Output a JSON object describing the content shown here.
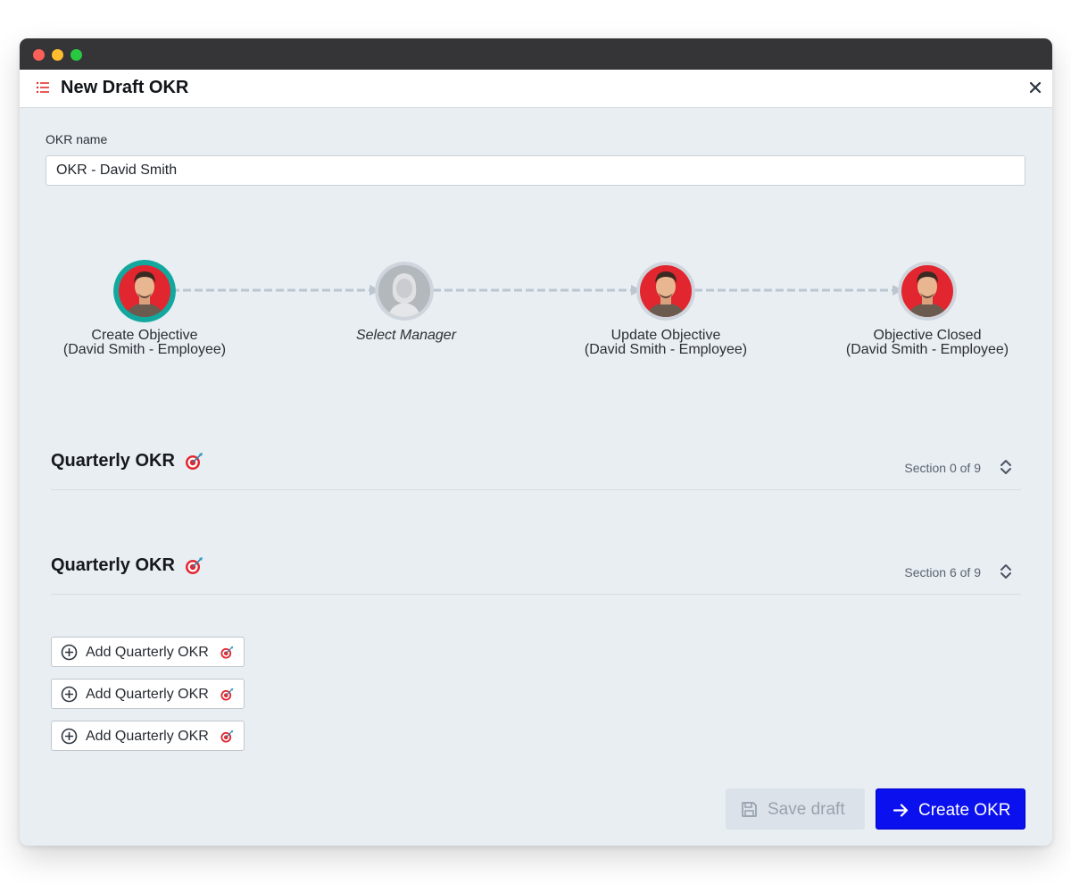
{
  "header": {
    "title": "New Draft OKR"
  },
  "form": {
    "okr_name_label": "OKR name",
    "okr_name_value": "OKR - David Smith"
  },
  "workflow": {
    "steps": [
      {
        "title": "Create Objective",
        "subtitle": "(David Smith - Employee)",
        "state": "active"
      },
      {
        "title": "Select Manager",
        "subtitle": "",
        "state": "placeholder"
      },
      {
        "title": "Update Objective",
        "subtitle": "(David Smith - Employee)",
        "state": "pending"
      },
      {
        "title": "Objective Closed",
        "subtitle": "(David Smith - Employee)",
        "state": "pending"
      }
    ]
  },
  "sections": [
    {
      "title": "Quarterly OKR",
      "counter": "Section 0 of 9"
    },
    {
      "title": "Quarterly OKR",
      "counter": "Section 6 of 9"
    }
  ],
  "add_buttons": [
    {
      "label": "Add Quarterly OKR"
    },
    {
      "label": "Add Quarterly OKR"
    },
    {
      "label": "Add Quarterly OKR"
    }
  ],
  "footer": {
    "save_label": "Save draft",
    "create_label": "Create OKR"
  },
  "colors": {
    "accent": "#0a10ee",
    "active_ring": "#13a89e",
    "brand_red": "#e2262f"
  }
}
